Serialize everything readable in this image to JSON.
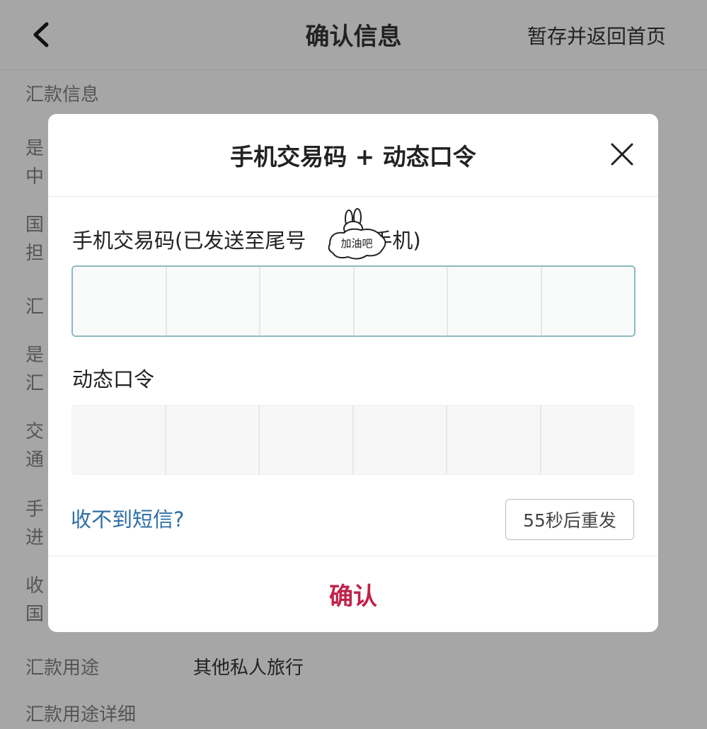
{
  "header": {
    "back_icon": "chevron-left-icon",
    "title": "确认信息",
    "save_return_label": "暂存并返回首页"
  },
  "background_rows": {
    "section_title": "汇款信息",
    "row1_line1": "是",
    "row1_line2": "中",
    "row2_line1": "国",
    "row2_line2": "担",
    "row3": "汇",
    "row4_line1": "是",
    "row4_line2": "汇",
    "row5_line1": "交",
    "row5_line2": "通",
    "row6_line1": "手",
    "row6_line2": "进",
    "row7_line1": "收",
    "row7_line2": "国",
    "purpose_label": "汇款用途",
    "purpose_value": "其他私人旅行",
    "purpose_detail_label": "汇款用途详细"
  },
  "modal": {
    "title": "手机交易码 + 动态口令",
    "close_icon": "close-icon",
    "sms_code_label": "手机交易码(已发送至尾号",
    "sms_code_label_tail": "的手机)",
    "sms_code_cells": [
      "",
      "",
      "",
      "",
      "",
      ""
    ],
    "dynamic_password_label": "动态口令",
    "dynamic_password_cells": [
      "",
      "",
      "",
      "",
      "",
      ""
    ],
    "no_sms_link": "收不到短信?",
    "resend_button": "55秒后重发",
    "confirm_button": "确认",
    "sticker_text": "加油吧"
  },
  "colors": {
    "overlay_background": "#a6a6a6",
    "link_blue": "#2e6ea4",
    "confirm_red": "#c0224a",
    "active_border": "#8fb8c2"
  }
}
